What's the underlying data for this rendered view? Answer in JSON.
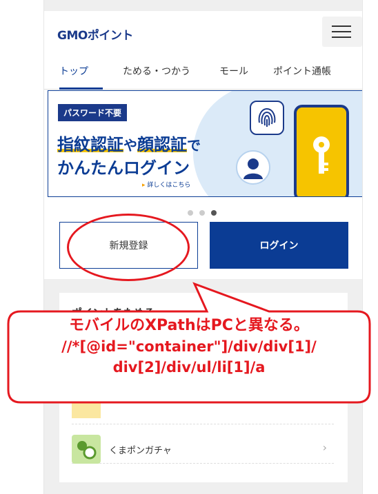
{
  "header": {
    "logo_text": "GMOポイント"
  },
  "tabs": [
    {
      "label": "トップ"
    },
    {
      "label": "ためる・つかう"
    },
    {
      "label": "モール"
    },
    {
      "label": "ポイント通帳"
    }
  ],
  "banner": {
    "badge": "パスワード不要",
    "headline_part1": "指紋認証",
    "headline_part2": "や",
    "headline_part3": "顔認証",
    "headline_part4": "で",
    "headline_line2": "かんたんログイン",
    "detail_link": "詳しくはこちら"
  },
  "carousel": {
    "total": 3,
    "active_index": 2
  },
  "buttons": {
    "register": "新規登録",
    "login": "ログイン"
  },
  "section": {
    "title": "ポイントをためる",
    "items": [
      {
        "label": "くまポンガチャ"
      }
    ]
  },
  "annotation": {
    "line1": "モバイルのXPathはPCと異なる。",
    "line2": "//*[@id=\"container\"]/div/div[1]/",
    "line3": "div[2]/div/ul/li[1]/a",
    "color": "#e5181f"
  },
  "colors": {
    "brand": "#0b3c94",
    "accent_yellow": "#f6c400",
    "background_gray": "#efefef"
  }
}
